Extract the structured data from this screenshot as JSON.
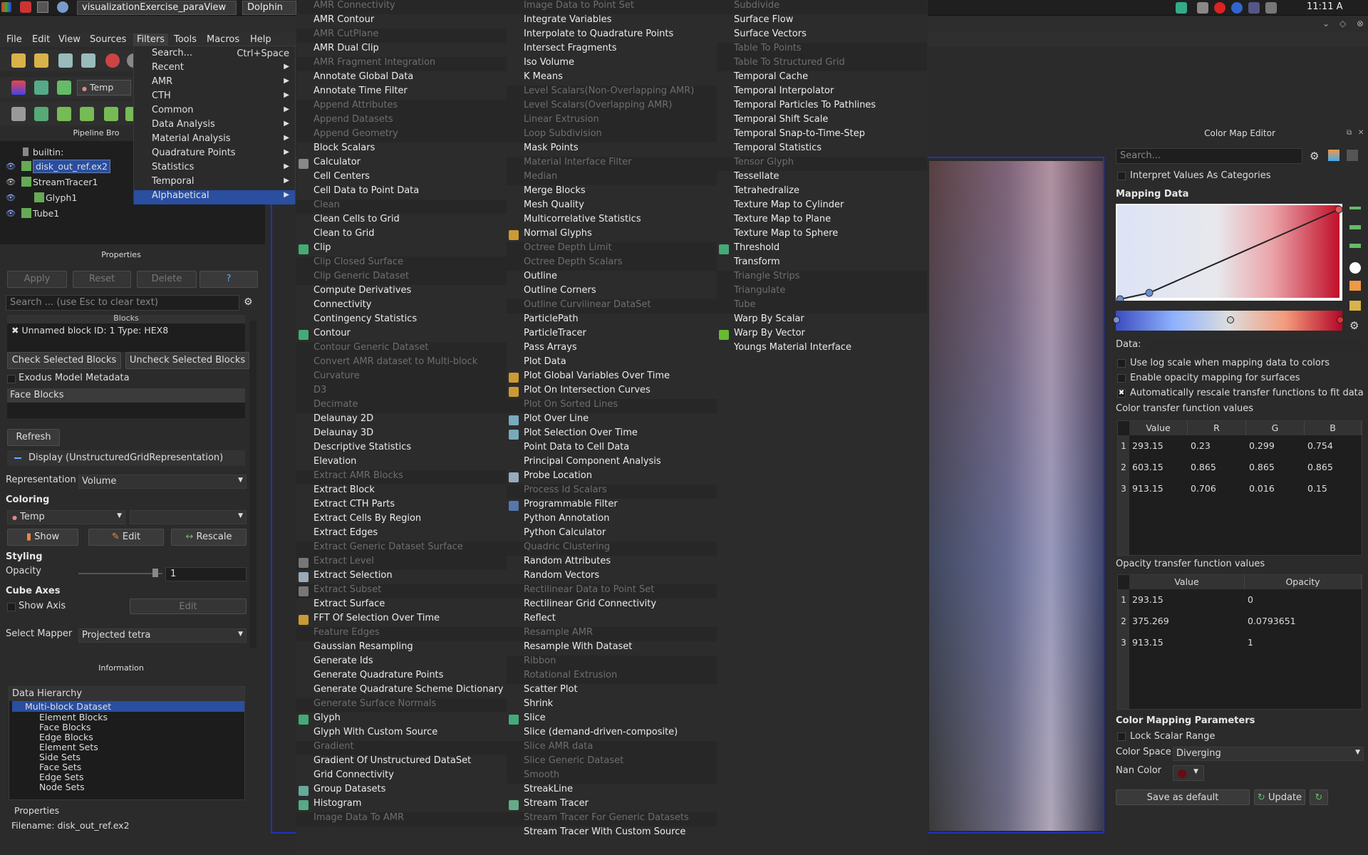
{
  "taskbar": {
    "task1": "visualizationExercise_paraView",
    "task2": "Dolphin",
    "clock": "11:11 A"
  },
  "menubar": [
    "File",
    "Edit",
    "View",
    "Sources",
    "Filters",
    "Tools",
    "Macros",
    "Help"
  ],
  "toolbar": {
    "variable": "Temp"
  },
  "pipeline": {
    "title": "Pipeline Bro",
    "items": [
      "builtin:",
      "disk_out_ref.ex2",
      "StreamTracer1",
      "Glyph1",
      "Tube1"
    ]
  },
  "properties": {
    "title": "Properties",
    "apply": "Apply",
    "reset": "Reset",
    "delete": "Delete",
    "help": "?",
    "search_placeholder": "Search ... (use Esc to clear text)",
    "blocks_header": "Blocks",
    "block_item": "Unnamed block ID: 1 Type: HEX8",
    "check_selected": "Check Selected Blocks",
    "uncheck_selected": "Uncheck Selected Blocks",
    "exodus_metadata": "Exodus Model Metadata",
    "face_blocks": "Face Blocks",
    "refresh": "Refresh",
    "display": "Display (UnstructuredGridRepresentation)",
    "representation_label": "Representation",
    "representation_value": "Volume",
    "coloring_header": "Coloring",
    "coloring_value": "Temp",
    "show": "Show",
    "edit": "Edit",
    "rescale": "Rescale",
    "styling_header": "Styling",
    "opacity_label": "Opacity",
    "opacity_value": "1",
    "cube_axes_header": "Cube Axes",
    "show_axis": "Show Axis",
    "cube_edit": "Edit",
    "select_mapper_label": "Select Mapper",
    "select_mapper_value": "Projected tetra"
  },
  "information": {
    "title": "Information",
    "header": "Data Hierarchy",
    "root": "Multi-block Dataset",
    "children": [
      "Element Blocks",
      "Face Blocks",
      "Edge Blocks",
      "Element Sets",
      "Side Sets",
      "Face Sets",
      "Edge Sets",
      "Node Sets"
    ],
    "properties_label": "Properties",
    "filename": "Filename:  disk_out_ref.ex2"
  },
  "filters_menu": [
    {
      "label": "Search...",
      "shortcut": "Ctrl+Space",
      "arrow": ""
    },
    {
      "label": "Recent",
      "shortcut": "",
      "arrow": "▶"
    },
    {
      "label": "AMR",
      "shortcut": "",
      "arrow": "▶"
    },
    {
      "label": "CTH",
      "shortcut": "",
      "arrow": "▶"
    },
    {
      "label": "Common",
      "shortcut": "",
      "arrow": "▶"
    },
    {
      "label": "Data Analysis",
      "shortcut": "",
      "arrow": "▶"
    },
    {
      "label": "Material Analysis",
      "shortcut": "",
      "arrow": "▶"
    },
    {
      "label": "Quadrature Points",
      "shortcut": "",
      "arrow": "▶"
    },
    {
      "label": "Statistics",
      "shortcut": "",
      "arrow": "▶"
    },
    {
      "label": "Temporal",
      "shortcut": "",
      "arrow": "▶"
    },
    {
      "label": "Alphabetical",
      "shortcut": "",
      "arrow": "▶"
    }
  ],
  "alpha_col1": [
    {
      "t": "AMR Connectivity",
      "d": 1
    },
    {
      "t": "AMR Contour"
    },
    {
      "t": "AMR CutPlane",
      "d": 1
    },
    {
      "t": "AMR Dual Clip"
    },
    {
      "t": "AMR Fragment Integration",
      "d": 1
    },
    {
      "t": "Annotate Global Data"
    },
    {
      "t": "Annotate Time Filter"
    },
    {
      "t": "Append Attributes",
      "d": 1
    },
    {
      "t": "Append Datasets",
      "d": 1
    },
    {
      "t": "Append Geometry",
      "d": 1
    },
    {
      "t": "Block Scalars"
    },
    {
      "t": "Calculator",
      "i": "#888"
    },
    {
      "t": "Cell Centers"
    },
    {
      "t": "Cell Data to Point Data"
    },
    {
      "t": "Clean",
      "d": 1
    },
    {
      "t": "Clean Cells to Grid"
    },
    {
      "t": "Clean to Grid"
    },
    {
      "t": "Clip",
      "i": "#4a7"
    },
    {
      "t": "Clip Closed Surface",
      "d": 1
    },
    {
      "t": "Clip Generic Dataset",
      "d": 1
    },
    {
      "t": "Compute Derivatives"
    },
    {
      "t": "Connectivity"
    },
    {
      "t": "Contingency Statistics"
    },
    {
      "t": "Contour",
      "i": "#4a7"
    },
    {
      "t": "Contour Generic Dataset",
      "d": 1
    },
    {
      "t": "Convert AMR dataset to Multi-block",
      "d": 1
    },
    {
      "t": "Curvature",
      "d": 1
    },
    {
      "t": "D3",
      "d": 1
    },
    {
      "t": "Decimate",
      "d": 1
    },
    {
      "t": "Delaunay 2D"
    },
    {
      "t": "Delaunay 3D"
    },
    {
      "t": "Descriptive Statistics"
    },
    {
      "t": "Elevation"
    },
    {
      "t": "Extract AMR Blocks",
      "d": 1
    },
    {
      "t": "Extract Block"
    },
    {
      "t": "Extract CTH Parts"
    },
    {
      "t": "Extract Cells By Region"
    },
    {
      "t": "Extract Edges"
    },
    {
      "t": "Extract Generic Dataset Surface",
      "d": 1
    },
    {
      "t": "Extract Level",
      "d": 1,
      "i": "#777"
    },
    {
      "t": "Extract Selection",
      "i": "#9ab"
    },
    {
      "t": "Extract Subset",
      "d": 1,
      "i": "#777"
    },
    {
      "t": "Extract Surface"
    },
    {
      "t": "FFT Of Selection Over Time",
      "i": "#c93"
    },
    {
      "t": "Feature Edges",
      "d": 1
    },
    {
      "t": "Gaussian Resampling"
    },
    {
      "t": "Generate Ids"
    },
    {
      "t": "Generate Quadrature Points"
    },
    {
      "t": "Generate Quadrature Scheme Dictionary"
    },
    {
      "t": "Generate Surface Normals",
      "d": 1
    },
    {
      "t": "Glyph",
      "i": "#4a7"
    },
    {
      "t": "Glyph With Custom Source"
    },
    {
      "t": "Gradient",
      "d": 1
    },
    {
      "t": "Gradient Of Unstructured DataSet"
    },
    {
      "t": "Grid Connectivity"
    },
    {
      "t": "Group Datasets",
      "i": "#6a9"
    },
    {
      "t": "Histogram",
      "i": "#5a8"
    },
    {
      "t": "Image Data To AMR",
      "d": 1
    }
  ],
  "alpha_col2": [
    {
      "t": "Image Data to Point Set",
      "d": 1
    },
    {
      "t": "Integrate Variables"
    },
    {
      "t": "Interpolate to Quadrature Points"
    },
    {
      "t": "Intersect Fragments"
    },
    {
      "t": "Iso Volume"
    },
    {
      "t": "K Means"
    },
    {
      "t": "Level Scalars(Non-Overlapping AMR)",
      "d": 1
    },
    {
      "t": "Level Scalars(Overlapping AMR)",
      "d": 1
    },
    {
      "t": "Linear Extrusion",
      "d": 1
    },
    {
      "t": "Loop Subdivision",
      "d": 1
    },
    {
      "t": "Mask Points"
    },
    {
      "t": "Material Interface Filter",
      "d": 1
    },
    {
      "t": "Median",
      "d": 1
    },
    {
      "t": "Merge Blocks"
    },
    {
      "t": "Mesh Quality"
    },
    {
      "t": "Multicorrelative Statistics"
    },
    {
      "t": "Normal Glyphs",
      "i": "#c93"
    },
    {
      "t": "Octree Depth Limit",
      "d": 1
    },
    {
      "t": "Octree Depth Scalars",
      "d": 1
    },
    {
      "t": "Outline"
    },
    {
      "t": "Outline Corners"
    },
    {
      "t": "Outline Curvilinear DataSet",
      "d": 1
    },
    {
      "t": "ParticlePath"
    },
    {
      "t": "ParticleTracer"
    },
    {
      "t": "Pass Arrays"
    },
    {
      "t": "Plot Data"
    },
    {
      "t": "Plot Global Variables Over Time",
      "i": "#c93"
    },
    {
      "t": "Plot On Intersection Curves",
      "i": "#c93"
    },
    {
      "t": "Plot On Sorted Lines",
      "d": 1
    },
    {
      "t": "Plot Over Line",
      "i": "#7ab"
    },
    {
      "t": "Plot Selection Over Time",
      "i": "#7ab"
    },
    {
      "t": "Point Data to Cell Data"
    },
    {
      "t": "Principal Component Analysis"
    },
    {
      "t": "Probe Location",
      "i": "#9ab"
    },
    {
      "t": "Process Id Scalars",
      "d": 1
    },
    {
      "t": "Programmable Filter",
      "i": "#57a"
    },
    {
      "t": "Python Annotation"
    },
    {
      "t": "Python Calculator"
    },
    {
      "t": "Quadric Clustering",
      "d": 1
    },
    {
      "t": "Random Attributes"
    },
    {
      "t": "Random Vectors"
    },
    {
      "t": "Rectilinear Data to Point Set",
      "d": 1
    },
    {
      "t": "Rectilinear Grid Connectivity"
    },
    {
      "t": "Reflect"
    },
    {
      "t": "Resample AMR",
      "d": 1
    },
    {
      "t": "Resample With Dataset"
    },
    {
      "t": "Ribbon",
      "d": 1
    },
    {
      "t": "Rotational Extrusion",
      "d": 1
    },
    {
      "t": "Scatter Plot"
    },
    {
      "t": "Shrink"
    },
    {
      "t": "Slice",
      "i": "#4a7"
    },
    {
      "t": "Slice (demand-driven-composite)"
    },
    {
      "t": "Slice AMR data",
      "d": 1
    },
    {
      "t": "Slice Generic Dataset",
      "d": 1
    },
    {
      "t": "Smooth",
      "d": 1
    },
    {
      "t": "StreakLine"
    },
    {
      "t": "Stream Tracer",
      "i": "#6a8"
    },
    {
      "t": "Stream Tracer For Generic Datasets",
      "d": 1
    },
    {
      "t": "Stream Tracer With Custom Source"
    }
  ],
  "alpha_col3": [
    {
      "t": "Subdivide",
      "d": 1
    },
    {
      "t": "Surface Flow"
    },
    {
      "t": "Surface Vectors"
    },
    {
      "t": "Table To Points",
      "d": 1
    },
    {
      "t": "Table To Structured Grid",
      "d": 1
    },
    {
      "t": "Temporal Cache"
    },
    {
      "t": "Temporal Interpolator"
    },
    {
      "t": "Temporal Particles To Pathlines"
    },
    {
      "t": "Temporal Shift Scale"
    },
    {
      "t": "Temporal Snap-to-Time-Step"
    },
    {
      "t": "Temporal Statistics"
    },
    {
      "t": "Tensor Glyph",
      "d": 1
    },
    {
      "t": "Tessellate"
    },
    {
      "t": "Tetrahedralize"
    },
    {
      "t": "Texture Map to Cylinder"
    },
    {
      "t": "Texture Map to Plane"
    },
    {
      "t": "Texture Map to Sphere"
    },
    {
      "t": "Threshold",
      "i": "#4a7"
    },
    {
      "t": "Transform"
    },
    {
      "t": "Triangle Strips",
      "d": 1
    },
    {
      "t": "Triangulate",
      "d": 1
    },
    {
      "t": "Tube",
      "d": 1
    },
    {
      "t": "Warp By Scalar"
    },
    {
      "t": "Warp By Vector",
      "i": "#6b3"
    },
    {
      "t": "Youngs Material Interface"
    }
  ],
  "colormap": {
    "title": "Color Map Editor",
    "search_placeholder": "Search...",
    "interpret": "Interpret Values As Categories",
    "mapping_data": "Mapping Data",
    "data_label": "Data:",
    "log_scale": "Use log scale when mapping data to colors",
    "enable_opacity": "Enable opacity mapping for surfaces",
    "auto_rescale": "Automatically rescale transfer functions to fit data",
    "ctf_label": "Color transfer function values",
    "ctf_headers": [
      "Value",
      "R",
      "G",
      "B"
    ],
    "ctf_rows": [
      [
        "293.15",
        "0.23",
        "0.299",
        "0.754"
      ],
      [
        "603.15",
        "0.865",
        "0.865",
        "0.865"
      ],
      [
        "913.15",
        "0.706",
        "0.016",
        "0.15"
      ]
    ],
    "otf_label": "Opacity transfer function values",
    "otf_headers": [
      "Value",
      "Opacity"
    ],
    "otf_rows": [
      [
        "293.15",
        "0"
      ],
      [
        "375.269",
        "0.0793651"
      ],
      [
        "913.15",
        "1"
      ]
    ],
    "params_header": "Color Mapping Parameters",
    "lock_range": "Lock Scalar Range",
    "color_space_label": "Color Space",
    "color_space_value": "Diverging",
    "nan_color_label": "Nan Color",
    "save_default": "Save as default",
    "update": "Update"
  }
}
